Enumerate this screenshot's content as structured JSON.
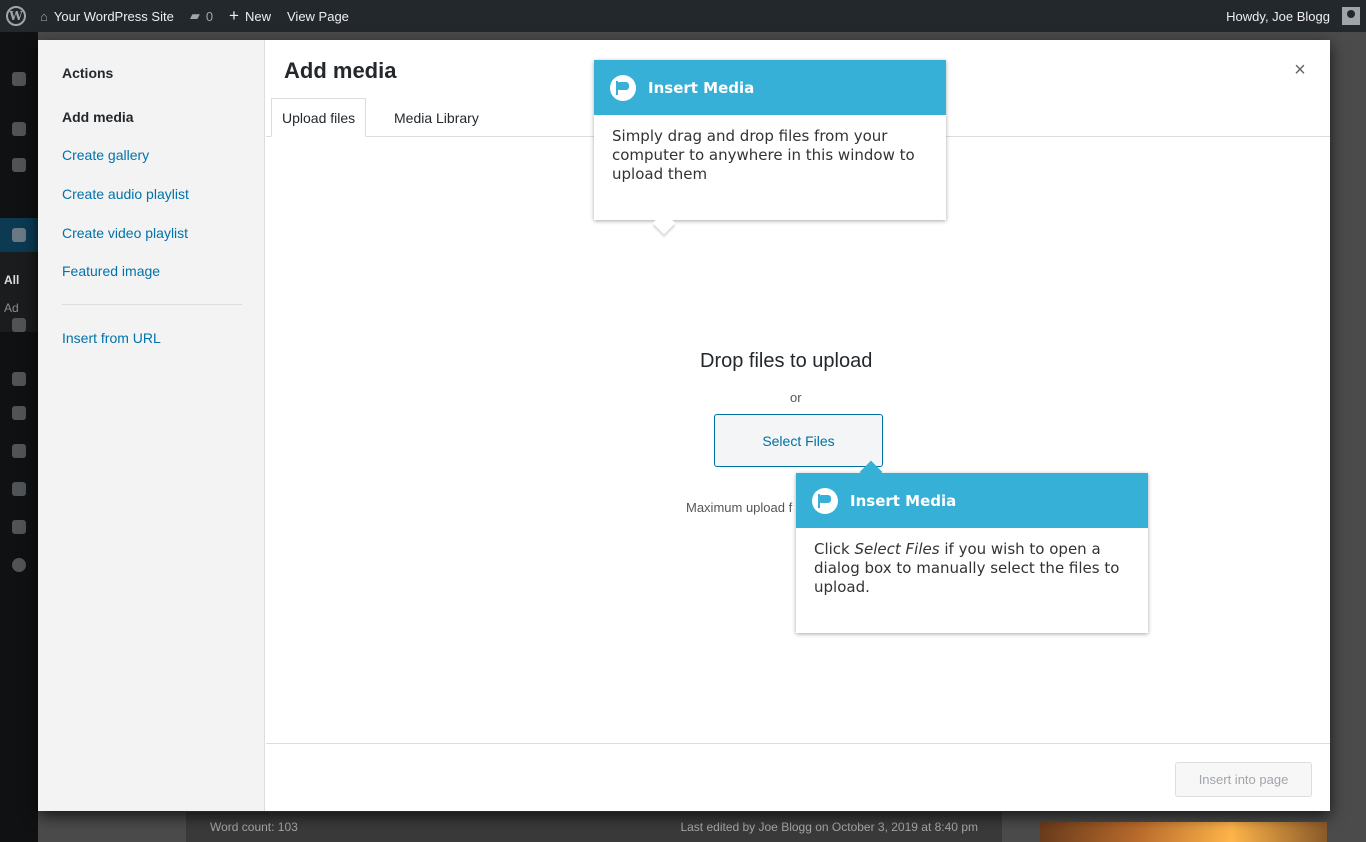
{
  "admin_bar": {
    "site_name": "Your WordPress Site",
    "comments_count": "0",
    "new_label": "New",
    "view_label": "View Page",
    "greeting": "Howdy, Joe Blogg"
  },
  "admin_menu": {
    "submenu": [
      "All",
      "Ad"
    ]
  },
  "background": {
    "word_count": "Word count: 103",
    "last_edited": "Last edited by Joe Blogg on October 3, 2019 at 8:40 pm"
  },
  "modal": {
    "title": "Add media",
    "close_symbol": "×",
    "menu": {
      "heading": "Actions",
      "items": [
        "Add media",
        "Create gallery",
        "Create audio playlist",
        "Create video playlist",
        "Featured image"
      ],
      "insert_url": "Insert from URL"
    },
    "tabs": [
      "Upload files",
      "Media Library"
    ],
    "uploader": {
      "title": "Drop files to upload",
      "or": "or",
      "select_button": "Select Files",
      "max_upload": "Maximum upload file size"
    },
    "toolbar": {
      "insert_button": "Insert into page"
    }
  },
  "tours": [
    {
      "title": "Insert Media",
      "body": "Simply drag and drop files from your computer to anywhere in this window to upload them"
    },
    {
      "title": "Insert Media",
      "body_pre": "Click ",
      "body_em": "Select Files",
      "body_post": " if you wish to open a dialog box to manually select the files to upload."
    }
  ],
  "colors": {
    "admin_bar": "#23282d",
    "link": "#0073aa",
    "tour_header": "#36b0d6"
  }
}
